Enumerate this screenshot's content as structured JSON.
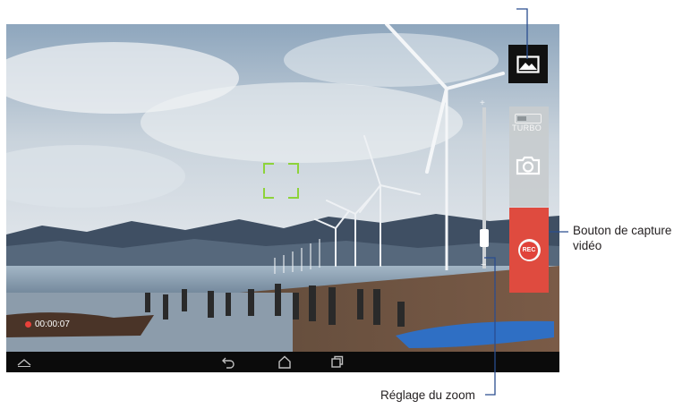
{
  "recording": {
    "time": "00:00:07"
  },
  "side_panel": {
    "turbo_label": "TURBO",
    "record_button_label": "REC"
  },
  "zoom": {
    "plus": "+",
    "minus": "−",
    "level": 0.15
  },
  "callouts": {
    "capture_button": "Bouton de capture vidéo",
    "zoom": "Réglage du zoom"
  },
  "icons": {
    "gallery": "gallery-icon",
    "camera": "camera-icon",
    "nav": [
      "hide-bar-icon",
      "back-icon",
      "home-icon",
      "recent-apps-icon"
    ]
  },
  "colors": {
    "record": "#df4b3f",
    "focus": "#8dd33a",
    "panel": "#c8ccce"
  }
}
